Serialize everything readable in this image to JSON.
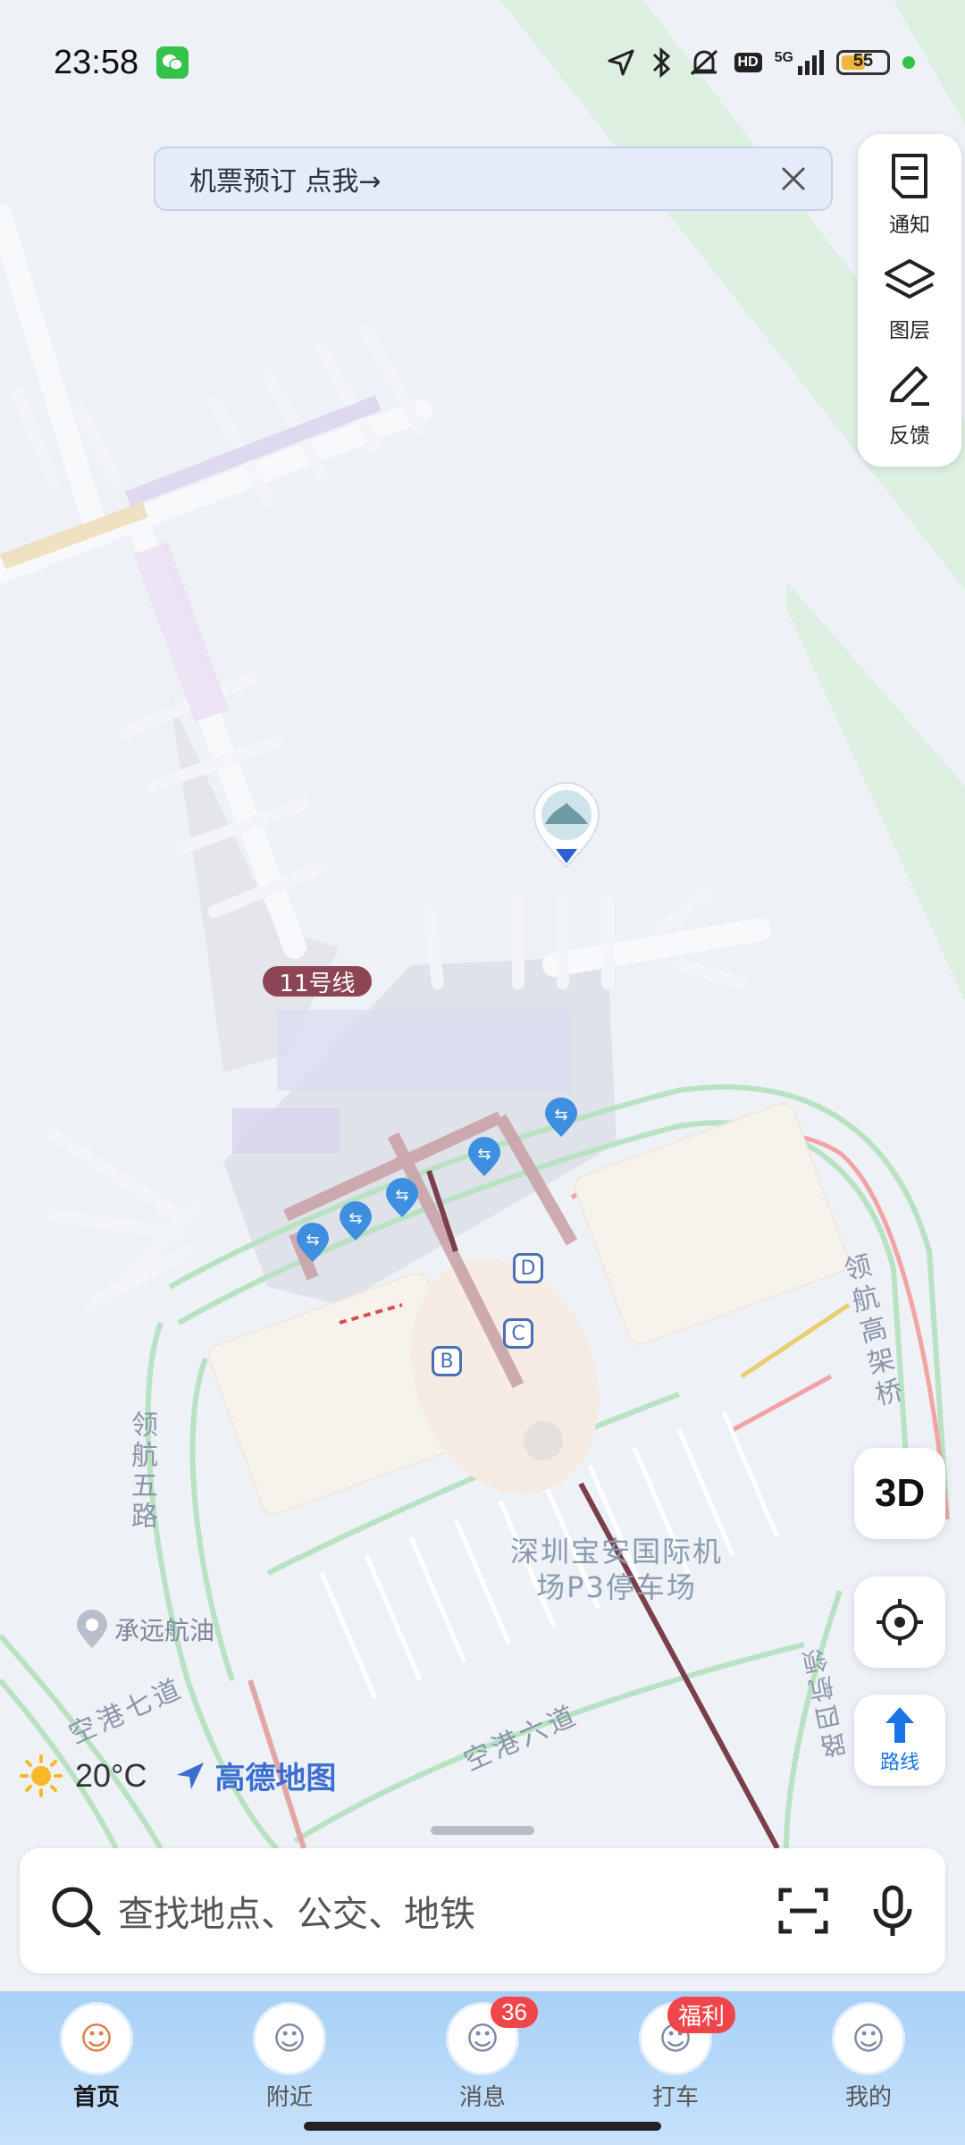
{
  "status_bar": {
    "time": "23:58",
    "network": "5G",
    "hd": "HD",
    "battery": "55",
    "battery_level": 0.55
  },
  "banner": {
    "text": "机票预订 点我→"
  },
  "side_panel": [
    {
      "label": "通知",
      "icon": "notice-icon"
    },
    {
      "label": "图层",
      "icon": "layers-icon"
    },
    {
      "label": "反馈",
      "icon": "feedback-edit-icon"
    }
  ],
  "map": {
    "metro_label": "11号线",
    "gates": [
      "D",
      "C",
      "B"
    ],
    "roads": [
      "领航高架桥",
      "领航五路",
      "空港七道",
      "空港六道",
      "路四航领"
    ],
    "poi": {
      "name": "承远航油"
    },
    "parking_label_line1": "深圳宝安国际机",
    "parking_label_line2": "场P3停车场"
  },
  "buttons": {
    "btn_3d": "3D",
    "route": "路线"
  },
  "weather": {
    "temperature": "20°C"
  },
  "brand": {
    "name": "高德地图"
  },
  "search": {
    "placeholder": "查找地点、公交、地铁"
  },
  "tabs": [
    {
      "label": "首页",
      "badge": "",
      "active": true
    },
    {
      "label": "附近",
      "badge": "",
      "active": false
    },
    {
      "label": "消息",
      "badge": "36",
      "active": false
    },
    {
      "label": "打车",
      "badge": "福利",
      "active": false
    },
    {
      "label": "我的",
      "badge": "",
      "active": false
    }
  ],
  "colors": {
    "accent": "#1a73e8",
    "badge": "#f0464b",
    "metro": "#8b4553"
  }
}
